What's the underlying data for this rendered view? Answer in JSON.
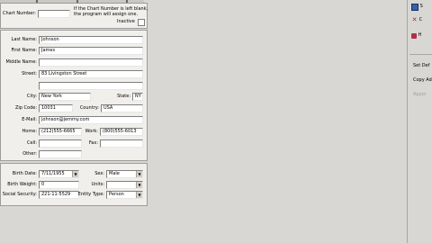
{
  "header": {
    "chart_number_label": "Chart Number:",
    "chart_number_value": "",
    "note_line1": "If the Chart Number is left blank,",
    "note_line2": "the program will assign one.",
    "inactive_label": "Inactive"
  },
  "patient": {
    "last_name_label": "Last Name:",
    "last_name": "Johnson",
    "first_name_label": "First Name:",
    "first_name": "James",
    "middle_name_label": "Middle Name:",
    "middle_name": "",
    "street_label": "Street:",
    "street": "83 Livingston Street",
    "street2": "",
    "city_label": "City:",
    "city": "New York",
    "state_label": "State:",
    "state": "NY",
    "zip_label": "Zip Code:",
    "zip": "10031",
    "country_label": "Country:",
    "country": "USA",
    "email_label": "E-Mail:",
    "email": "johnson@jemmy.com",
    "home_label": "Home:",
    "home": "(212)555-6665",
    "work_label": "Work:",
    "work": "(800)555-6013",
    "cell_label": "Cell:",
    "cell": "",
    "fax_label": "Fax:",
    "fax": "",
    "other_label": "Other:",
    "other": ""
  },
  "demographics": {
    "birth_date_label": "Birth Date:",
    "birth_date": "7/11/1955",
    "sex_label": "Sex:",
    "sex": "Male",
    "birth_weight_label": "Birth Weight:",
    "birth_weight": "0",
    "units_label": "Units:",
    "units": "",
    "ssn_label": "Social Security:",
    "ssn": "221-11-5529",
    "entity_type_label": "Entity Type:",
    "entity_type": "Person"
  },
  "toolbar": {
    "save_label": "S",
    "cancel_label": "C",
    "help_label": "H",
    "set_default_label": "Set Def",
    "copy_address_label": "Copy Add",
    "appointments_label": "Appoi"
  },
  "colors": {
    "save_icon": "#3b5fa8",
    "cancel_icon": "#c0241a",
    "help_icon": "#b0304a"
  }
}
